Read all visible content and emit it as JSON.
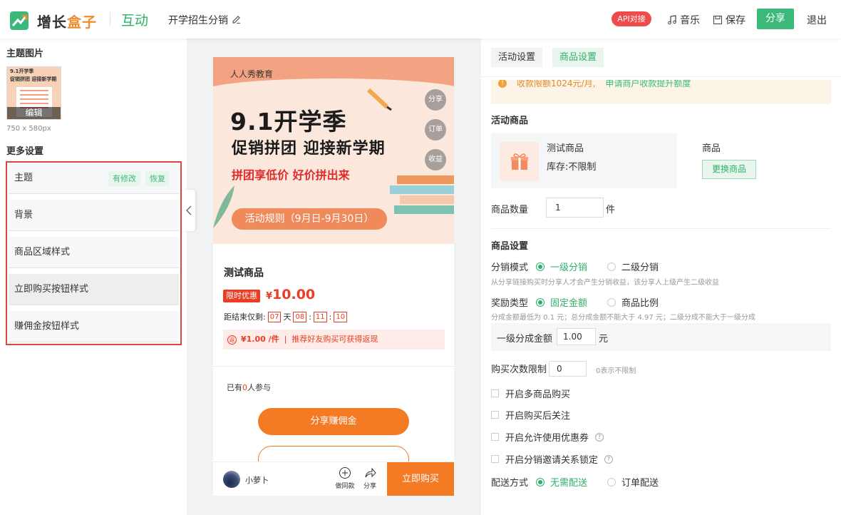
{
  "header": {
    "logo_text_part1": "增长",
    "logo_text_part2": "盒子",
    "module": "互动",
    "activity_title": "开学招生分销",
    "api_badge": "API对接",
    "music": "音乐",
    "save": "保存",
    "share": "分享",
    "exit": "退出"
  },
  "left": {
    "theme_image_title": "主题图片",
    "thumb_line1": "9.1开学季",
    "thumb_line2": "促销拼团 迎接新学期",
    "thumb_edit": "编辑",
    "thumb_size": "750 x 580px",
    "more_settings_title": "更多设置",
    "items": [
      {
        "label": "主题"
      },
      {
        "label": "背景"
      },
      {
        "label": "商品区域样式"
      },
      {
        "label": "立即购买按钮样式"
      },
      {
        "label": "赚佣金按钮样式"
      }
    ],
    "modified_tag": "有修改",
    "restore_tag": "恢复"
  },
  "preview": {
    "org": "人人秀教育",
    "headline": "9.1开学季",
    "subheadline": "促销拼团 迎接新学期",
    "slogan": "拼团享低价 好价拼出来",
    "rule_button": "活动规则（9月日-9月30日）",
    "float_share": "分享",
    "float_order": "订单",
    "float_income": "收益",
    "product_name": "测试商品",
    "limited_tag": "限时优惠",
    "currency": "¥",
    "price": "10.00",
    "countdown_label": "距结束仅剩:",
    "cd_days": "07",
    "cd_day_unit": "天",
    "cd_hours": "08",
    "cd_minutes": "11",
    "cd_seconds": "10",
    "rebate_icon": "返",
    "rebate_amount": "¥1.00 /件",
    "rebate_text": "推荐好友购买可获得返现",
    "joined_prefix": "已有",
    "joined_count": "0",
    "joined_suffix": "人参与",
    "share_earn_button": "分享赚佣金",
    "user_name": "小萝卜",
    "same_style": "做同款",
    "share": "分享",
    "buy_now": "立即购买"
  },
  "right": {
    "tabs": [
      {
        "label": "活动设置"
      },
      {
        "label": "商品设置"
      }
    ],
    "notice_icon": "!",
    "notice_text": "收款限额1024元/月,",
    "notice_link": "申请商户收款提升额度",
    "active_product_title": "活动商品",
    "product_name": "测试商品",
    "product_stock": "库存:不限制",
    "product_label": "商品",
    "change_product": "更换商品",
    "quantity_label": "商品数量",
    "quantity_value": "1",
    "quantity_unit": "件",
    "product_settings_title": "商品设置",
    "dist_mode_label": "分销模式",
    "dist_mode_opt1": "一级分销",
    "dist_mode_opt2": "二级分销",
    "dist_mode_hint": "从分享链接购买时分享人才会产生分销收益，该分享人上级产生二级收益",
    "reward_type_label": "奖励类型",
    "reward_opt1": "固定金额",
    "reward_opt2": "商品比例",
    "reward_hint": "分成金额最低为 0.1 元；总分成金额不能大于 4.97 元；二级分成不能大于一级分成",
    "level1_label": "一级分成金额",
    "level1_value": "1.00",
    "level1_unit": "元",
    "purchase_limit_label": "购买次数限制",
    "purchase_limit_value": "0",
    "purchase_limit_hint": "0表示不限制",
    "checkbox_1": "开启多商品购买",
    "checkbox_2": "开启购买后关注",
    "checkbox_3": "开启允许使用优惠券",
    "checkbox_4": "开启分销邀请关系锁定",
    "help": "?",
    "delivery_label": "配送方式",
    "delivery_opt1": "无需配送",
    "delivery_opt2": "订单配送"
  },
  "colors": {
    "brand_green": "#2fb06a",
    "orange": "#f47a24",
    "red": "#ea3d24",
    "highlight_border": "#e0463e"
  }
}
